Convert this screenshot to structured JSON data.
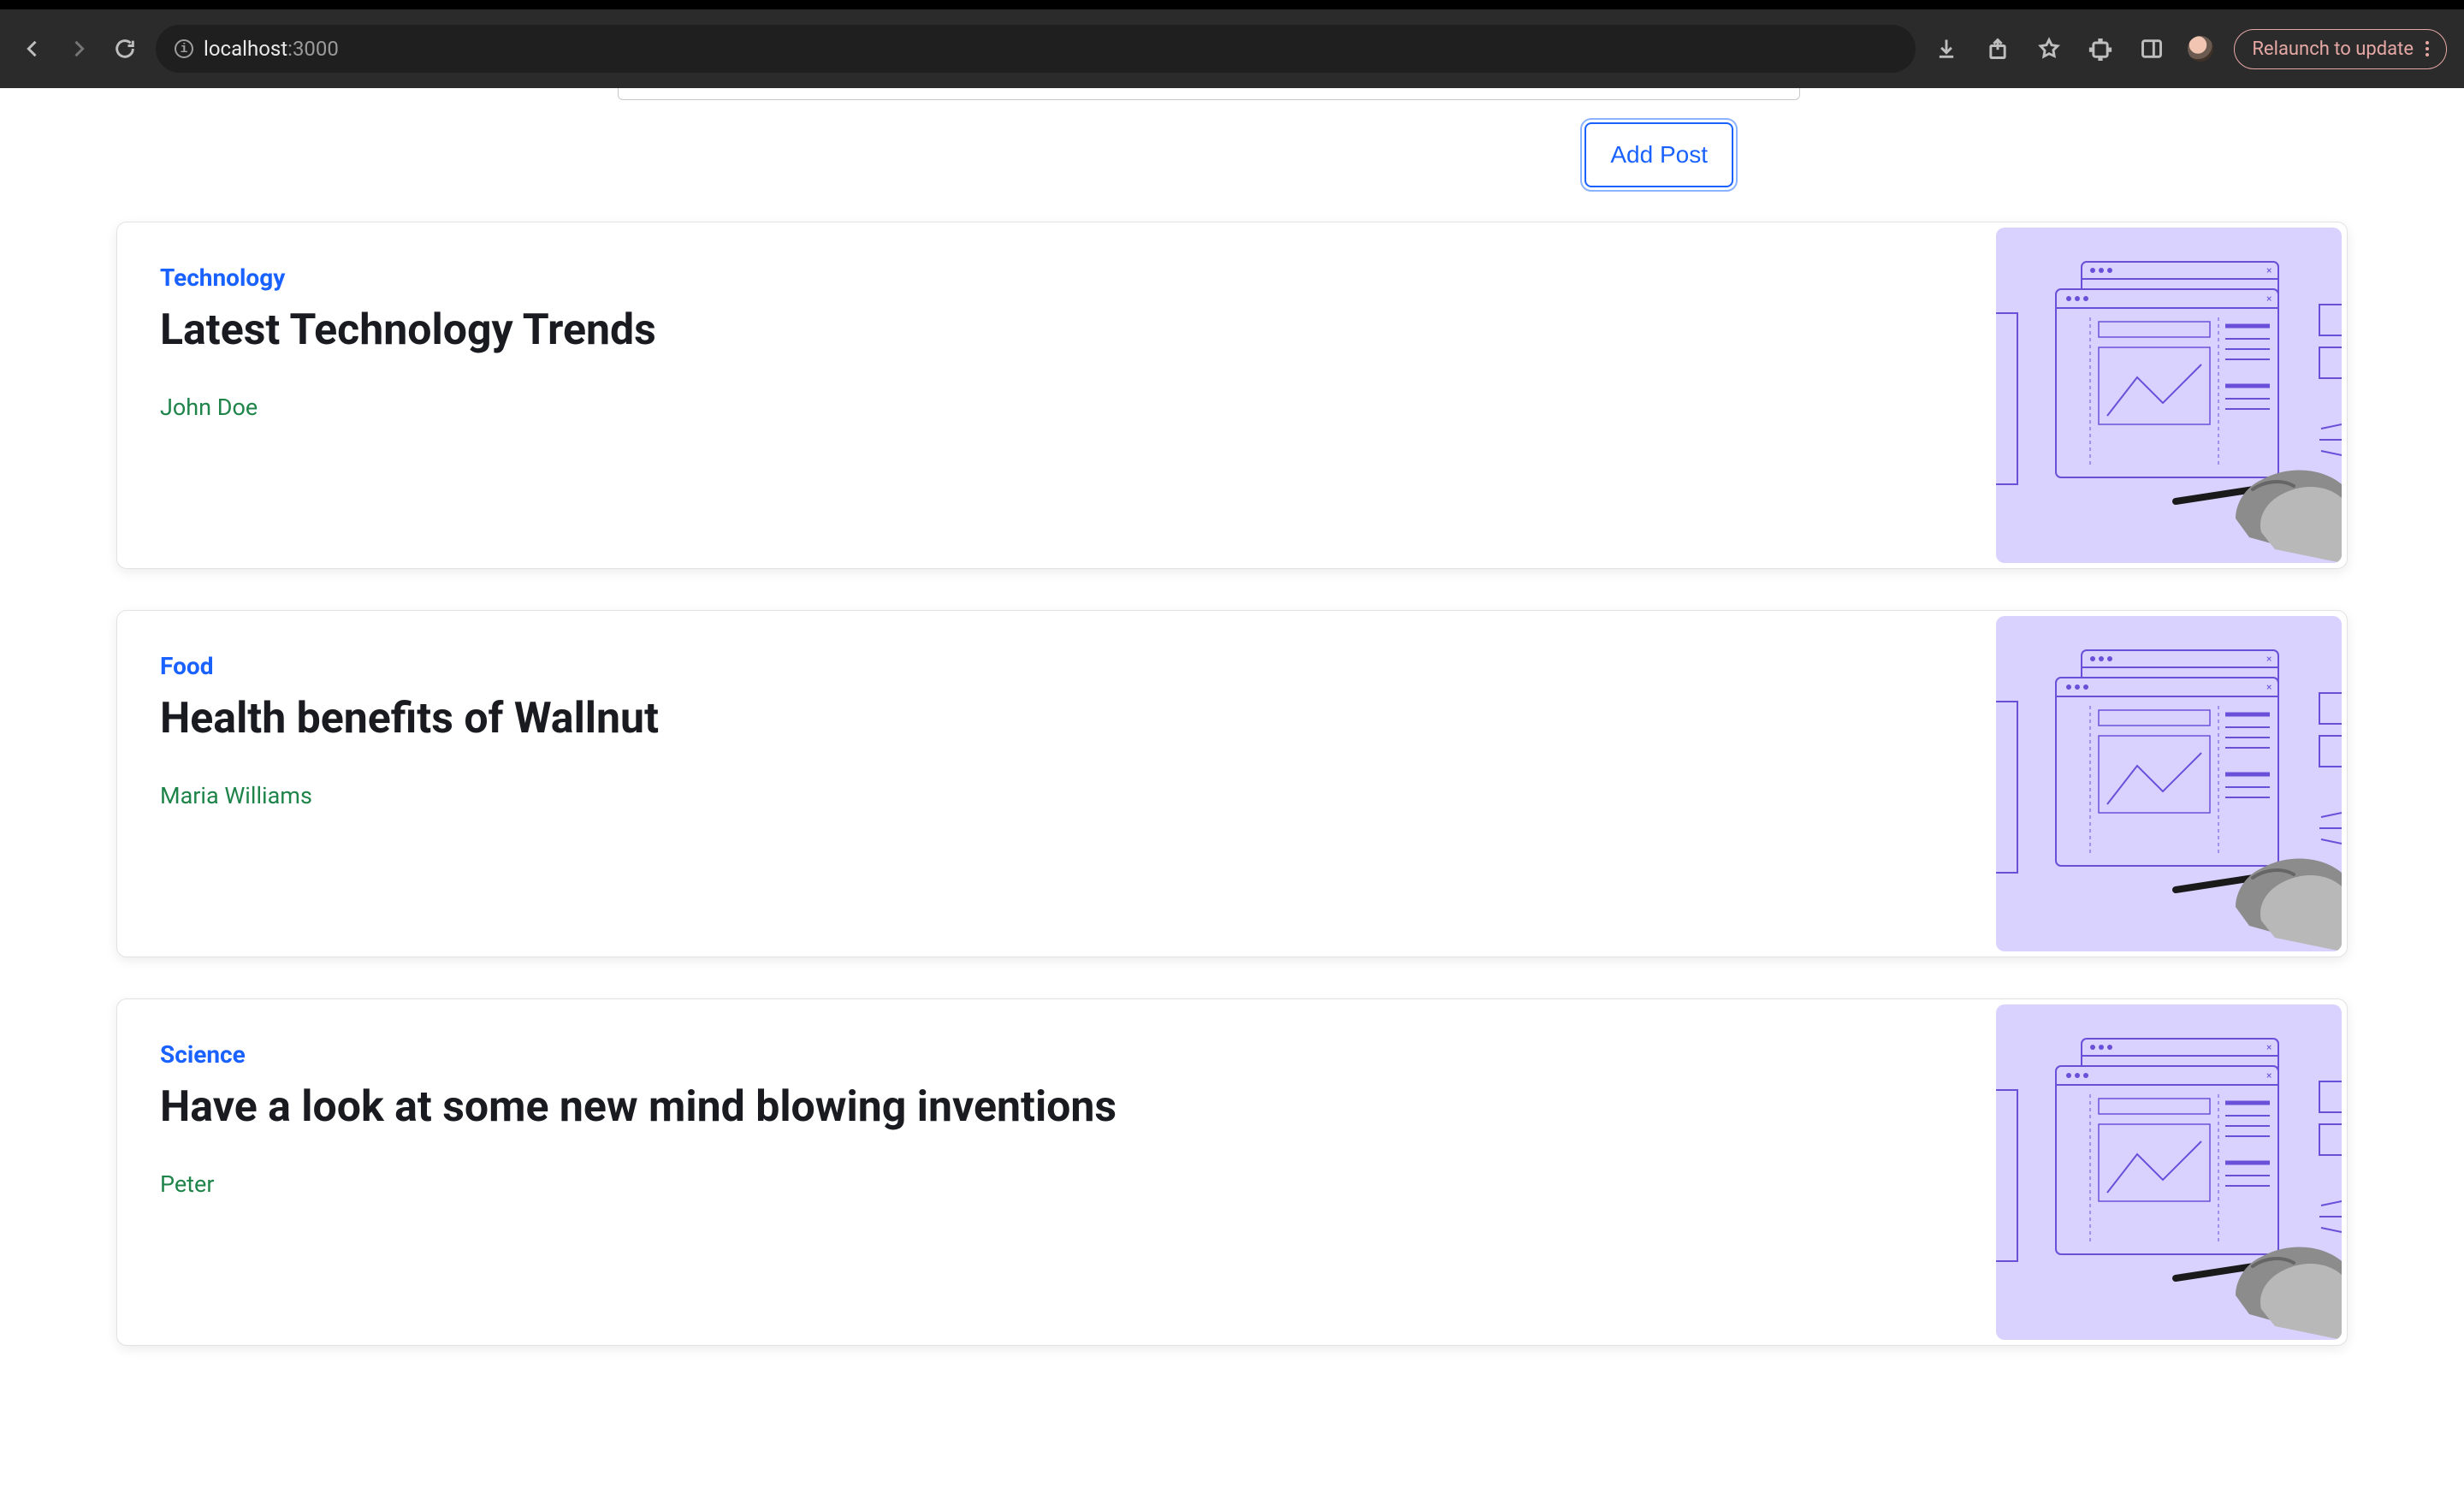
{
  "browser": {
    "url_host": "localhost",
    "url_port": ":3000",
    "relaunch_label": "Relaunch to update"
  },
  "actions": {
    "add_post_label": "Add Post"
  },
  "posts": [
    {
      "category": "Technology",
      "title": "Latest Technology Trends",
      "author": "John Doe"
    },
    {
      "category": "Food",
      "title": "Health benefits of Wallnut",
      "author": "Maria Williams"
    },
    {
      "category": "Science",
      "title": "Have a look at some new mind blowing inventions",
      "author": "Peter"
    }
  ]
}
